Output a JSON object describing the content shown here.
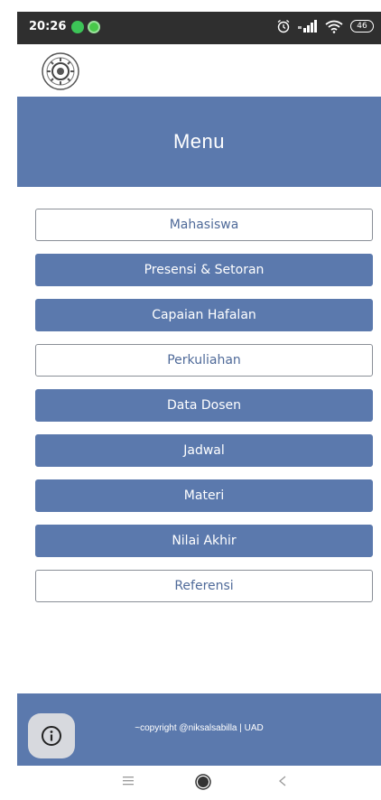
{
  "status_bar": {
    "time": "20:26",
    "battery": "46"
  },
  "header": {
    "title": "Menu"
  },
  "menu": {
    "items": [
      {
        "label": "Mahasiswa",
        "style": "outline"
      },
      {
        "label": "Presensi & Setoran",
        "style": "filled"
      },
      {
        "label": "Capaian Hafalan",
        "style": "filled"
      },
      {
        "label": "Perkuliahan",
        "style": "outline"
      },
      {
        "label": "Data Dosen",
        "style": "filled"
      },
      {
        "label": "Jadwal",
        "style": "filled"
      },
      {
        "label": "Materi",
        "style": "filled"
      },
      {
        "label": "Nilai Akhir",
        "style": "filled"
      },
      {
        "label": "Referensi",
        "style": "outline"
      }
    ]
  },
  "footer": {
    "copyright": "~copyright @niksalsabilla | UAD"
  },
  "icons": {
    "status_app_1": "whatsapp-icon",
    "status_app_2": "android-app-icon",
    "alarm": "alarm-clock-icon",
    "signal": "signal-strength-icon",
    "wifi": "wifi-icon",
    "battery": "battery-icon",
    "logo": "university-logo",
    "info": "info-icon",
    "nav_menu": "recent-apps-icon",
    "nav_home": "home-icon",
    "nav_back": "back-icon"
  },
  "colors": {
    "primary": "#5b79ad",
    "outline_text": "#4f6a99",
    "status_bar": "#2f2f2f",
    "fab_bg": "#d7d9de"
  }
}
